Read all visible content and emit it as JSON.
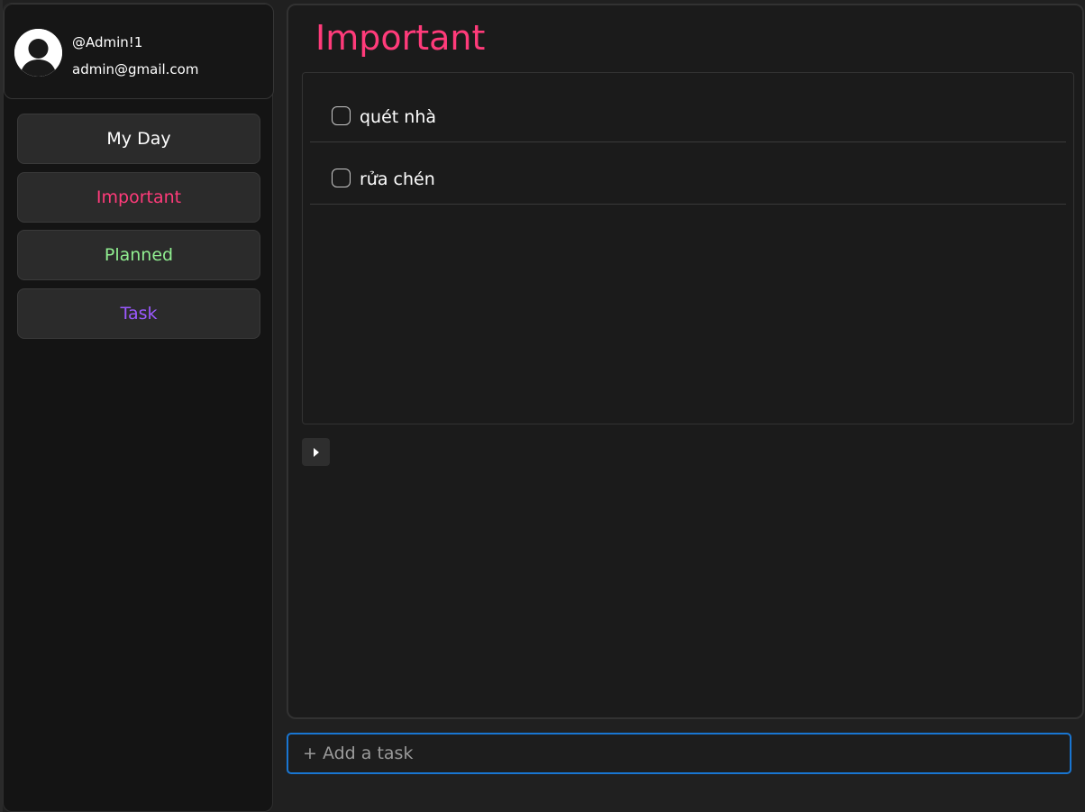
{
  "user": {
    "username": "@Admin!1",
    "email": "admin@gmail.com"
  },
  "nav": {
    "items": [
      {
        "label": "My Day",
        "color": "#ffffff"
      },
      {
        "label": "Important",
        "color": "#ff3b7a"
      },
      {
        "label": "Planned",
        "color": "#90ee90"
      },
      {
        "label": "Task",
        "color": "#9b59ff"
      }
    ]
  },
  "main": {
    "title": "Important",
    "title_color": "#ff3b7a",
    "tasks": [
      {
        "label": "quét nhà",
        "checked": false
      },
      {
        "label": "rửa chén",
        "checked": false
      }
    ],
    "expand_icon": "caret-right-icon"
  },
  "add_task": {
    "placeholder": "+ Add a task"
  },
  "colors": {
    "input_focus_border": "#1976d2"
  }
}
